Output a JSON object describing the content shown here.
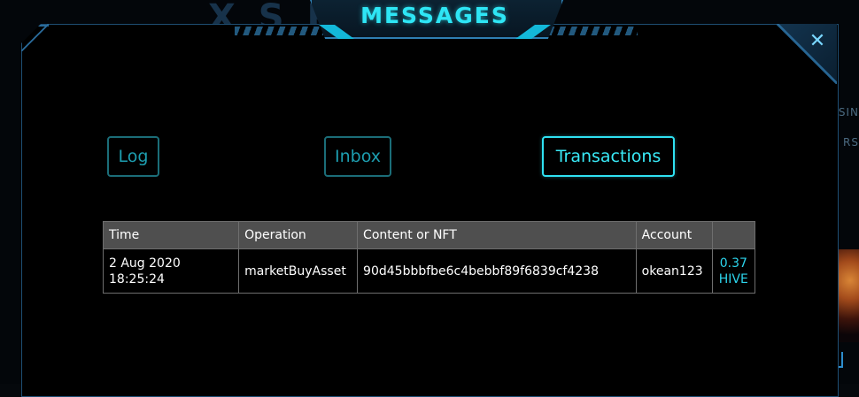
{
  "window": {
    "title": "MESSAGES",
    "close_label": "✕"
  },
  "background": {
    "logo_text": "X  S K G",
    "side_text_a": "SIN",
    "side_text_b": "RS"
  },
  "tabs": [
    {
      "label": "Log",
      "active": false
    },
    {
      "label": "Inbox",
      "active": false
    },
    {
      "label": "Transactions",
      "active": true
    }
  ],
  "table": {
    "headers": [
      "Time",
      "Operation",
      "Content or NFT",
      "Account",
      ""
    ],
    "rows": [
      {
        "time_date": "2 Aug 2020",
        "time_clock": "18:25:24",
        "operation": "marketBuyAsset",
        "content": "90d45bbbfbe6c4bebbf89f6839cf4238",
        "account": "okean123",
        "amount_value": "0.37",
        "amount_unit": "HIVE"
      }
    ]
  },
  "colors": {
    "accent": "#2ee6f5",
    "tab_inactive": "#1d9eb0",
    "header_bg": "#4f4f4f",
    "amount": "#2cd4ec"
  }
}
